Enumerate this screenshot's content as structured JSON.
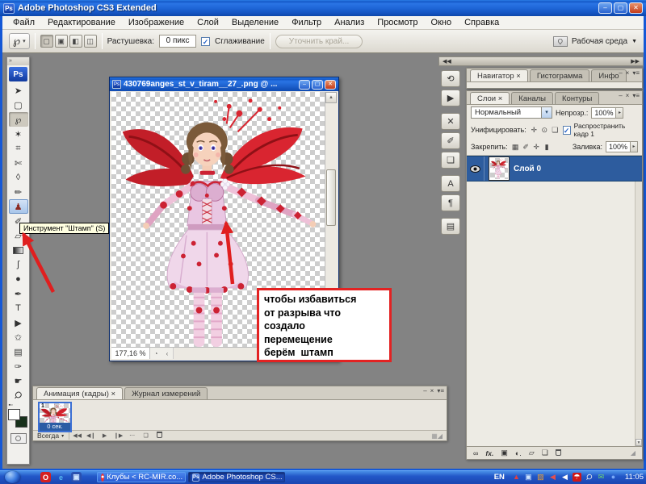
{
  "colors": {
    "accent_blue": "#2d5c9e",
    "arrow_red": "#e01f1f",
    "note_border": "#e32222",
    "titlebar_blue": "#1f66d8",
    "workspace_gray": "#838383",
    "taskbar_blue": "#2a5fd0"
  },
  "titlebar": {
    "logo": "Ps",
    "title": "Adobe Photoshop CS3 Extended"
  },
  "icons": {
    "minimize": "–",
    "maximize": "▢",
    "close": "✕",
    "dropdown": "▼",
    "combo_arrow": "▾",
    "spin_arrow": "▸",
    "panel_menu": "▾≡",
    "mini_close": "×",
    "mini_minimize": "–",
    "chevrons_left": "◀◀",
    "chevrons_right": "▶▶",
    "scroll_up": "▲",
    "scroll_down": "▼",
    "scroll_left": "‹",
    "clock_icon": "◔",
    "grip": "◢",
    "toolbox_chevrons": "»",
    "check": "✓"
  },
  "menu": {
    "items": [
      "Файл",
      "Редактирование",
      "Изображение",
      "Слой",
      "Выделение",
      "Фильтр",
      "Анализ",
      "Просмотр",
      "Окно",
      "Справка"
    ]
  },
  "options": {
    "active_tool_glyph": "℘",
    "mode_buttons": [
      {
        "name": "new-selection-mode",
        "glyph": "▢"
      },
      {
        "name": "add-selection-mode",
        "glyph": "▣"
      },
      {
        "name": "subtract-selection-mode",
        "glyph": "◧"
      },
      {
        "name": "intersect-selection-mode",
        "glyph": "◫"
      }
    ],
    "feather_label": "Растушевка:",
    "feather_value": "0 пикс",
    "antialias_label": "Сглаживание",
    "refine_edge_label": "Уточнить край...",
    "workspace_label": "Рабочая среда"
  },
  "toolbox": {
    "logo": "Ps",
    "tooltip": "Инструмент \"Штамп\" (S)",
    "tools": [
      {
        "name": "move-tool",
        "glyph": "➤"
      },
      {
        "name": "marquee-tool",
        "glyph": "▢"
      },
      {
        "name": "lasso-tool",
        "glyph": "℘",
        "selected": true
      },
      {
        "name": "magic-wand-tool",
        "glyph": "✶"
      },
      {
        "name": "crop-tool",
        "glyph": "⌗"
      },
      {
        "name": "slice-tool",
        "glyph": "✄"
      },
      {
        "name": "healing-brush-tool",
        "glyph": "◊"
      },
      {
        "name": "brush-tool",
        "glyph": "✏"
      },
      {
        "name": "clone-stamp-tool",
        "glyph": "♟",
        "highlight": true
      },
      {
        "name": "history-brush-tool",
        "glyph": "✐"
      },
      {
        "name": "eraser-tool",
        "glyph": "▱"
      },
      {
        "name": "gradient-tool",
        "glyph": ""
      },
      {
        "name": "smudge-tool",
        "glyph": "ʃ"
      },
      {
        "name": "dodge-tool",
        "glyph": "●"
      },
      {
        "name": "pen-tool",
        "glyph": "✒"
      },
      {
        "name": "type-tool",
        "glyph": "T"
      },
      {
        "name": "path-selection-tool",
        "glyph": "▶"
      },
      {
        "name": "shape-tool",
        "glyph": "✩"
      },
      {
        "name": "notes-tool",
        "glyph": "▤"
      },
      {
        "name": "eyedropper-tool",
        "glyph": "✑"
      },
      {
        "name": "hand-tool",
        "glyph": "☛"
      },
      {
        "name": "zoom-tool",
        "glyph": "Ϙ"
      }
    ]
  },
  "document": {
    "icon": "Ps",
    "title": "430769anges_st_v_tiram__27_.png @ ...",
    "zoom": "177,16 %"
  },
  "note": {
    "lines": [
      "чтобы избавиться",
      "от разрыва что",
      "создало",
      "перемещение",
      "берём  штамп"
    ]
  },
  "animation": {
    "tab_frames": "Анимация (кадры) ×",
    "tab_log": "Журнал измерений",
    "frame_number": "1",
    "frame_delay": "0 сек.",
    "loop_value": "Всегда",
    "playback": [
      {
        "name": "first-frame-button",
        "glyph": "◀◀"
      },
      {
        "name": "previous-frame-button",
        "glyph": "◀❙"
      },
      {
        "name": "play-button",
        "glyph": "▶"
      },
      {
        "name": "next-frame-button",
        "glyph": "❙▶"
      },
      {
        "name": "tween-button",
        "glyph": "⋯"
      },
      {
        "name": "new-frame-button",
        "glyph": "❏"
      },
      {
        "name": "delete-frame-button",
        "glyph": "",
        "trash": true
      }
    ],
    "right_icons": [
      {
        "name": "convert-to-timeline-icon",
        "glyph": "▦"
      }
    ]
  },
  "dock_strip": [
    {
      "name": "history-icon",
      "glyph": "⟲"
    },
    {
      "name": "actions-icon",
      "glyph": "▶"
    },
    {
      "name": "tool-presets-icon",
      "glyph": "✕"
    },
    {
      "name": "brushes-icon",
      "glyph": "✐"
    },
    {
      "name": "clone-source-icon",
      "glyph": "❏"
    },
    {
      "name": "character-icon",
      "glyph": "A"
    },
    {
      "name": "paragraph-icon",
      "glyph": "¶"
    },
    {
      "name": "layer-comps-icon",
      "glyph": "▤"
    }
  ],
  "panels": {
    "nav_tabs": [
      "Навигатор ×",
      "Гистограмма",
      "Инфо"
    ],
    "layers_tabs": [
      "Слои ×",
      "Каналы",
      "Контуры"
    ],
    "blend_mode": "Нормальный",
    "opacity_label": "Непрозр.:",
    "opacity_value": "100%",
    "unify_label": "Унифицировать:",
    "unify_icons": [
      {
        "name": "unify-position-icon",
        "glyph": "✛"
      },
      {
        "name": "unify-visibility-icon",
        "glyph": "⊙"
      },
      {
        "name": "unify-style-icon",
        "glyph": "❏"
      }
    ],
    "propagate_label": "Распространить кадр 1",
    "lock_label": "Закрепить:",
    "lock_icons": [
      {
        "name": "lock-transparency-icon",
        "glyph": "▦"
      },
      {
        "name": "lock-pixels-icon",
        "glyph": "✐"
      },
      {
        "name": "lock-position-icon",
        "glyph": "✛"
      },
      {
        "name": "lock-all-icon",
        "glyph": "▮"
      }
    ],
    "fill_label": "Заливка:",
    "fill_value": "100%",
    "layer_name": "Слой 0",
    "bottom_icons": [
      {
        "name": "link-layers-icon",
        "glyph": "∞"
      },
      {
        "name": "layer-effects-icon",
        "glyph": "fx.",
        "italic": true
      },
      {
        "name": "layer-mask-icon",
        "glyph": "▣"
      },
      {
        "name": "adjustment-layer-icon",
        "glyph": "◐."
      },
      {
        "name": "layer-group-icon",
        "glyph": "▱"
      },
      {
        "name": "new-layer-icon",
        "glyph": "❏"
      },
      {
        "name": "delete-layer-icon",
        "glyph": "",
        "trash": true
      }
    ]
  },
  "taskbar": {
    "quick_launch": [
      {
        "name": "opera-icon",
        "glyph": "O",
        "color": "#fff",
        "bg": "#d42020"
      },
      {
        "name": "ie-icon",
        "glyph": "e",
        "color": "#58b8f0",
        "bg": "transparent"
      },
      {
        "name": "show-desktop-icon",
        "glyph": "▣",
        "color": "#cfe4ff",
        "bg": "#2a50b0"
      }
    ],
    "task1_icon": "●",
    "task1": "Клубы < RC-MIR.co...",
    "task2_icon": "Ps",
    "task2": "Adobe Photoshop CS...",
    "lang": "EN",
    "tray_icons": [
      {
        "name": "alert-triangle-icon",
        "glyph": "▲",
        "color": "#e04040",
        "bg": "transparent"
      },
      {
        "name": "network-monitor-icon",
        "glyph": "▣",
        "color": "#cfe4ff",
        "bg": "transparent"
      },
      {
        "name": "updates-icon",
        "glyph": "▨",
        "color": "#f0a030",
        "bg": "transparent"
      },
      {
        "name": "volume-muted-icon",
        "glyph": "◀",
        "color": "#e05050",
        "bg": "transparent"
      },
      {
        "name": "volume-icon",
        "glyph": "◀",
        "color": "#ffffff",
        "bg": "transparent"
      },
      {
        "name": "avira-antivirus-icon",
        "glyph": "☂",
        "color": "#ffffff",
        "bg": "#d01818"
      },
      {
        "name": "search-tray-icon",
        "glyph": "Ϙ",
        "color": "#e8e8e8",
        "bg": "transparent"
      },
      {
        "name": "messenger-icon",
        "glyph": "✉",
        "color": "#70d870",
        "bg": "transparent"
      },
      {
        "name": "bluetooth-icon",
        "glyph": "●",
        "color": "#78a8f8",
        "bg": "transparent"
      }
    ],
    "time": "11:05"
  }
}
